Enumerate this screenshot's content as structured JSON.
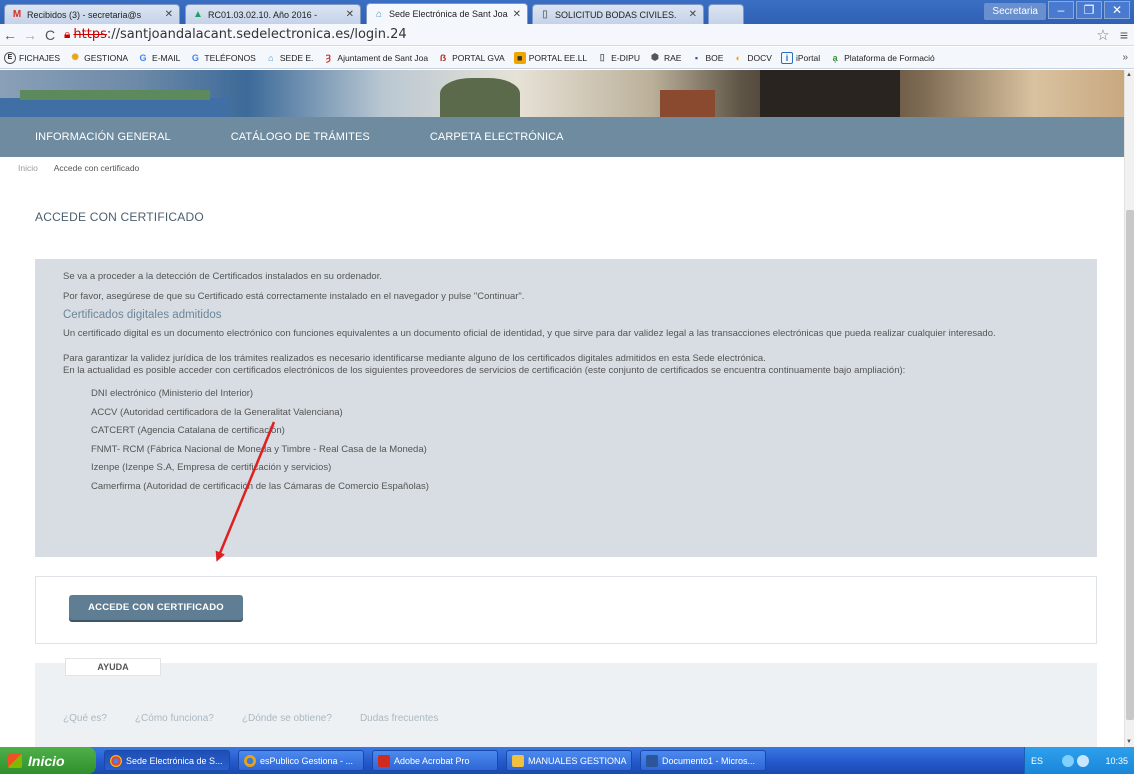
{
  "browser": {
    "tabs": [
      {
        "label": "Recibidos (3) - secretaria@s",
        "icon": "gmail-icon"
      },
      {
        "label": "RC01.03.02.10. Año 2016 -",
        "icon": "drive-icon"
      },
      {
        "label": "Sede Electrónica de Sant Joa",
        "icon": "sede-icon",
        "active": true
      },
      {
        "label": "SOLICITUD BODAS CIVILES.",
        "icon": "document-icon"
      }
    ],
    "user_label": "Secretaria",
    "url_scheme": "https",
    "url_rest": "://santjoandalacant.sedelectronica.es/login.24",
    "bookmarks": [
      "FICHAJES",
      "GESTIONA",
      "E-MAIL",
      "TELÉFONOS",
      "SEDE E.",
      "Ajuntament de Sant Joa",
      "PORTAL GVA",
      "PORTAL EE.LL",
      "E-DIPU",
      "RAE",
      "BOE",
      "DOCV",
      "iPortal",
      "Plataforma de Formació"
    ],
    "bookmarks_more": "»"
  },
  "nav": {
    "items": [
      "INFORMACIÓN GENERAL",
      "CATÁLOGO DE TRÁMITES",
      "CARPETA ELECTRÓNICA"
    ]
  },
  "breadcrumb": {
    "home": "Inicio",
    "current": "Accede con certificado"
  },
  "page": {
    "title": "ACCEDE CON CERTIFICADO",
    "intro1": "Se va a proceder a la detección de Certificados instalados en su ordenador.",
    "intro2": "Por favor, asegúrese de que su Certificado está correctamente instalado en el navegador y pulse \"Continuar\".",
    "subtitle": "Certificados digitales admitidos",
    "para1": "Un certificado digital es un documento electrónico con funciones equivalentes a un documento oficial de identidad, y que sirve para dar validez legal a las transacciones electrónicas que pueda realizar cualquier interesado.",
    "para2a": "Para garantizar la validez jurídica de los trámites realizados es necesario identificarse mediante alguno de los certificados digitales admitidos en esta Sede electrónica.",
    "para2b": "En la actualidad es posible acceder con certificados electrónicos de los siguientes proveedores de servicios de certificación (este conjunto de certificados se encuentra continuamente bajo ampliación):",
    "providers": [
      "DNI electrónico (Ministerio del Interior)",
      "ACCV (Autoridad certificadora de la Generalitat Valenciana)",
      "CATCERT (Agencia Catalana de certificación)",
      "FNMT- RCM (Fábrica Nacional de Moneda y Timbre - Real Casa de la Moneda)",
      "Izenpe (Izenpe S.A, Empresa de certificación y servicios)",
      "Camerfirma (Autoridad de certificación de las Cámaras de Comercio Españolas)"
    ],
    "button": "ACCEDE CON CERTIFICADO"
  },
  "help": {
    "tab": "AYUDA",
    "links": [
      "¿Qué es?",
      "¿Cómo funciona?",
      "¿Dónde se obtiene?",
      "Dudas frecuentes"
    ]
  },
  "taskbar": {
    "start": "Inicio",
    "tasks": [
      {
        "label": "Sede Electrónica de S...",
        "color": "#e94235"
      },
      {
        "label": "esPublico Gestiona - ...",
        "color": "#e8a317"
      },
      {
        "label": "Adobe Acrobat Pro",
        "color": "#d12a1e"
      },
      {
        "label": "MANUALES GESTIONA",
        "color": "#f0c040"
      },
      {
        "label": "Documento1 - Micros...",
        "color": "#2b579a"
      }
    ],
    "lang": "ES",
    "clock": "10:35"
  },
  "colors": {
    "nav_bg": "#6f8b9f",
    "info_bg": "#d7dde2",
    "button_bg": "#5f7d93",
    "annotation_arrow": "#e02020"
  }
}
